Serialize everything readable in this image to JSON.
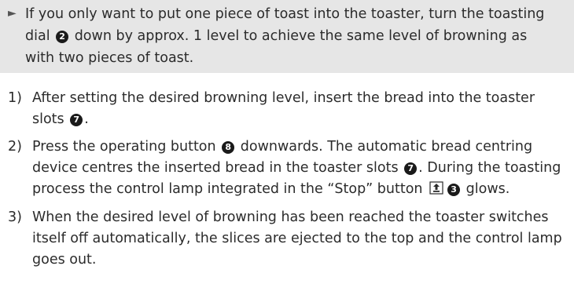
{
  "note": {
    "arrow": "►",
    "line1a": "If you only want to put one piece of toast into the toaster, turn the toasting",
    "line2a": "dial ",
    "line2_badge": "2",
    "line2b": " down by approx. 1 level to achieve the same level of browning as",
    "line3": "with two pieces of toast."
  },
  "steps": [
    {
      "num": "1)",
      "line1": "After setting the desired browning level, insert the bread into the toaster",
      "line2a": "slots ",
      "badge": "7",
      "line2b": "."
    },
    {
      "num": "2)",
      "line1a": "Press the operating button ",
      "badge1": "8",
      "line1b": " downwards. The automatic bread centring",
      "line2a": "device centres the inserted bread in the toaster slots ",
      "badge2": "7",
      "line2b": ". During the toasting",
      "line3a": "process the control lamp integrated in the “Stop” button ",
      "badge3": "3",
      "line3b": " glows."
    },
    {
      "num": "3)",
      "line1": "When the desired level of browning has been reached the toaster switches",
      "line2": "itself off automatically, the slices are ejected to the top and the control lamp",
      "line3": "goes out."
    }
  ],
  "icons": {
    "stop_button": "stop-button-icon"
  }
}
